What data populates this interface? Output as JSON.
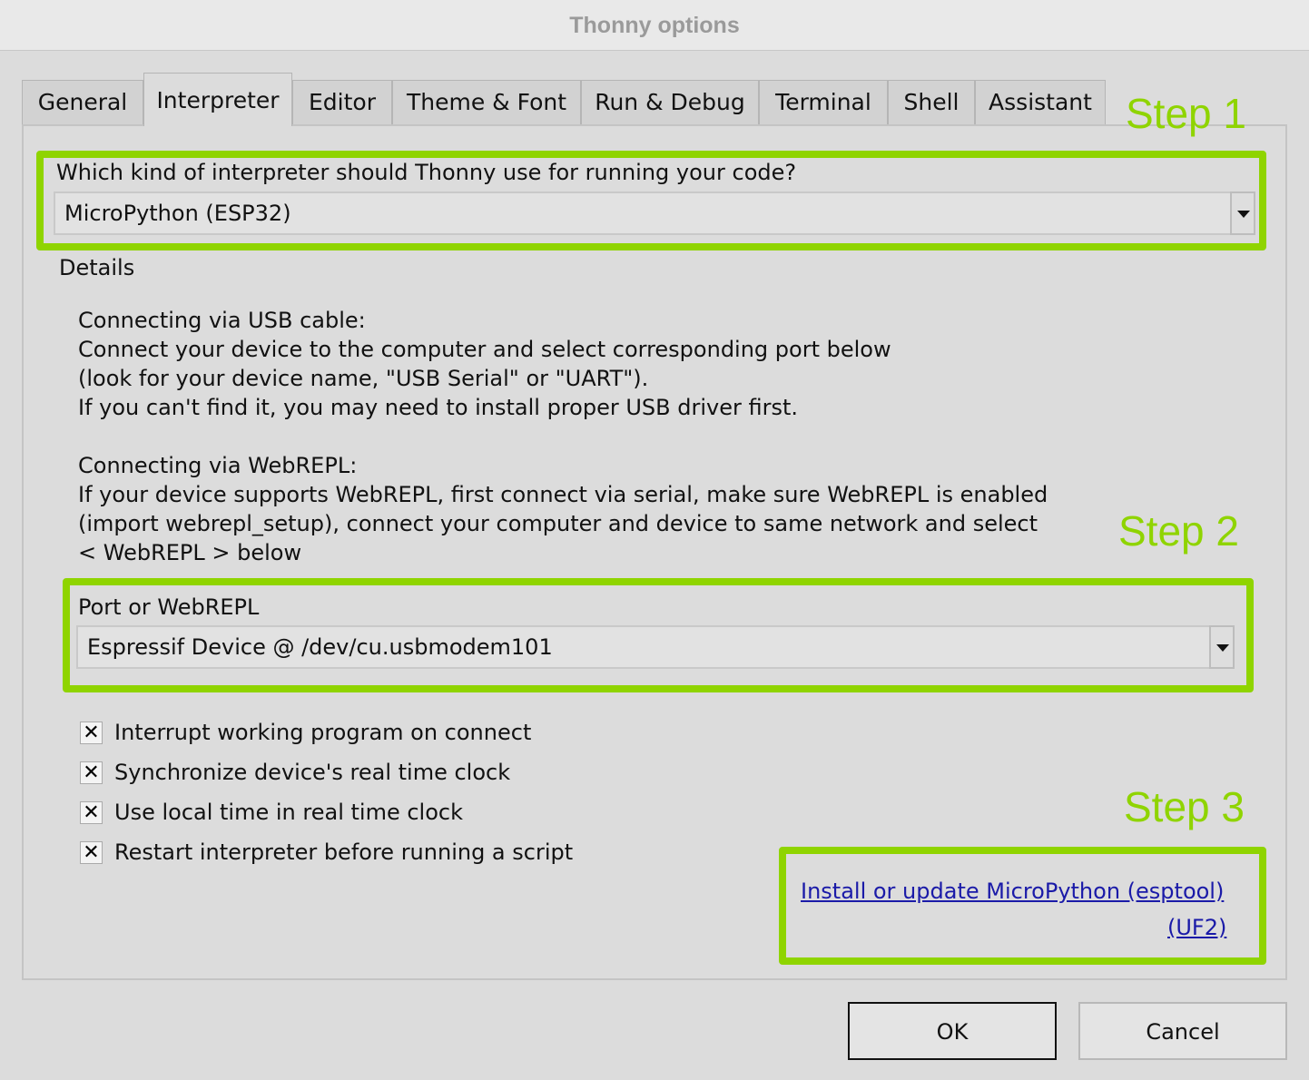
{
  "window": {
    "title": "Thonny options"
  },
  "tabs": [
    {
      "label": "General",
      "active": false
    },
    {
      "label": "Interpreter",
      "active": true
    },
    {
      "label": "Editor",
      "active": false
    },
    {
      "label": "Theme & Font",
      "active": false
    },
    {
      "label": "Run & Debug",
      "active": false
    },
    {
      "label": "Terminal",
      "active": false
    },
    {
      "label": "Shell",
      "active": false
    },
    {
      "label": "Assistant",
      "active": false
    }
  ],
  "interpreter": {
    "question": "Which kind of interpreter should Thonny use for running your code?",
    "selected": "MicroPython (ESP32)"
  },
  "details": {
    "heading": "Details",
    "lines": [
      "Connecting via USB cable:",
      "Connect your device to the computer and select corresponding port below",
      "(look for your device name, \"USB Serial\" or \"UART\").",
      "If you can't find it, you may need to install proper USB driver first.",
      "",
      "Connecting via WebREPL:",
      "If your device supports WebREPL, first connect via serial, make sure WebREPL is enabled",
      "(import webrepl_setup), connect your computer and device to same network and select",
      "< WebREPL > below"
    ]
  },
  "port": {
    "label": "Port or WebREPL",
    "selected": "Espressif Device @ /dev/cu.usbmodem101"
  },
  "options": [
    {
      "label": "Interrupt working program on connect",
      "checked": true
    },
    {
      "label": "Synchronize device's real time clock",
      "checked": true
    },
    {
      "label": "Use local time in real time clock",
      "checked": true
    },
    {
      "label": "Restart interpreter before running a script",
      "checked": true
    }
  ],
  "links": {
    "esptool": "Install or update MicroPython (esptool)",
    "uf2": "(UF2)"
  },
  "annotations": {
    "step1": "Step 1",
    "step2": "Step 2",
    "step3": "Step 3",
    "color": "#8fd400"
  },
  "buttons": {
    "ok": "OK",
    "cancel": "Cancel"
  }
}
